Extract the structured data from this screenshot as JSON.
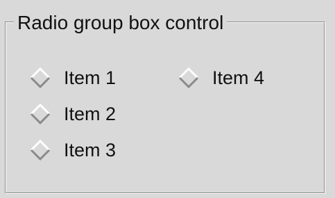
{
  "groupbox": {
    "title": "Radio group box control"
  },
  "radio_items": [
    {
      "label": "Item 1",
      "selected": false
    },
    {
      "label": "Item 2",
      "selected": false
    },
    {
      "label": "Item 3",
      "selected": false
    },
    {
      "label": "Item 4",
      "selected": false
    }
  ],
  "colors": {
    "background": "#d9d9d9",
    "shadow": "#8a8a8a",
    "highlight": "#ffffff",
    "text": "#111111"
  }
}
